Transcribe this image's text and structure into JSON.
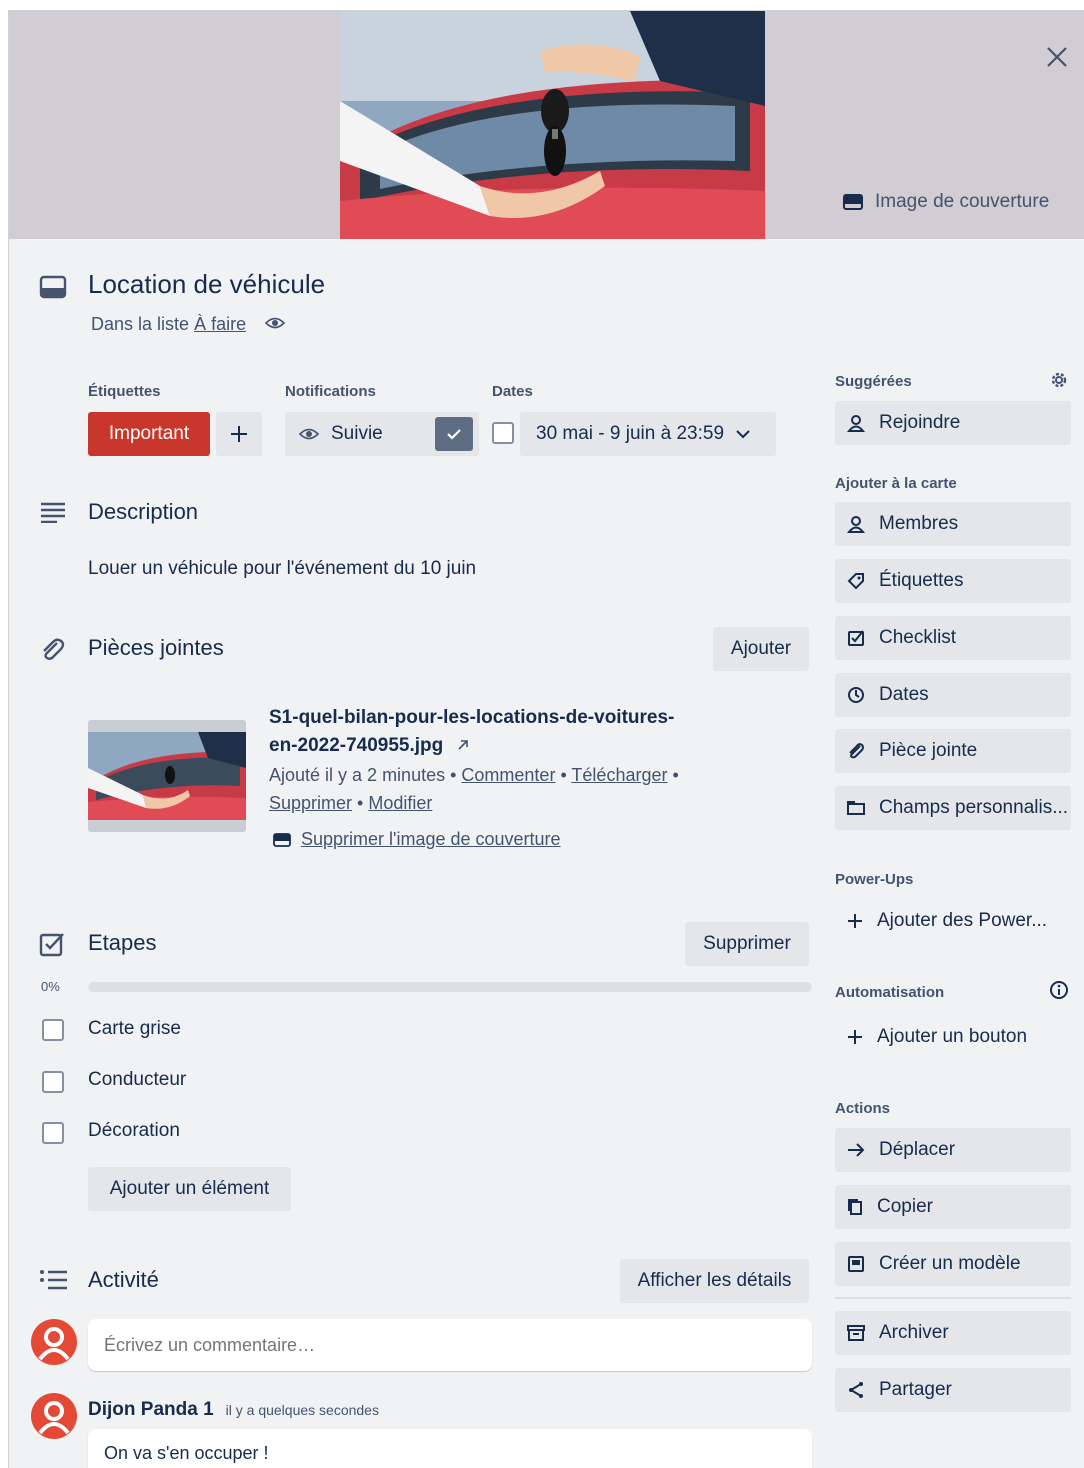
{
  "header": {
    "cover_button": "Image de couverture",
    "card_title": "Location de véhicule",
    "in_list_prefix": "Dans la liste",
    "list_name": "À faire"
  },
  "labels": {
    "labels_heading": "Étiquettes",
    "label_important": "Important",
    "notifications_heading": "Notifications",
    "watch_label": "Suivie",
    "dates_heading": "Dates",
    "dates_value": "30 mai - 9 juin à 23:59"
  },
  "description": {
    "heading": "Description",
    "text": "Louer un véhicule pour l'événement du 10 juin"
  },
  "attachments": {
    "heading": "Pièces jointes",
    "add_button": "Ajouter",
    "file_name_line1": "S1-quel-bilan-pour-les-locations-de-voitures-",
    "file_name_line2": "en-2022-740955.jpg",
    "added": "Ajouté il y a 2 minutes",
    "comment": "Commenter",
    "download": "Télécharger",
    "delete": "Supprimer",
    "edit": "Modifier",
    "remove_cover": "Supprimer l'image de couverture"
  },
  "checklist": {
    "heading": "Etapes",
    "delete_button": "Supprimer",
    "percent": "0%",
    "progress": 0,
    "items": [
      {
        "label": "Carte grise",
        "checked": false
      },
      {
        "label": "Conducteur",
        "checked": false
      },
      {
        "label": "Décoration",
        "checked": false
      }
    ],
    "add_item": "Ajouter un élément"
  },
  "activity": {
    "heading": "Activité",
    "details_button": "Afficher les détails",
    "comment_placeholder": "Écrivez un commentaire…",
    "comments": [
      {
        "author": "Dijon Panda 1",
        "time": "il y a quelques secondes",
        "text": "On va s'en occuper !"
      }
    ]
  },
  "sidebar": {
    "suggested_heading": "Suggérées",
    "join": "Rejoindre",
    "add_to_card_heading": "Ajouter à la carte",
    "add_items": [
      "Membres",
      "Étiquettes",
      "Checklist",
      "Dates",
      "Pièce jointe",
      "Champs personnalis..."
    ],
    "powerups_heading": "Power-Ups",
    "add_powerups": "Ajouter des Power...",
    "automation_heading": "Automatisation",
    "add_button": "Ajouter un bouton",
    "actions_heading": "Actions",
    "actions": [
      "Déplacer",
      "Copier",
      "Créer un modèle"
    ],
    "archive": "Archiver",
    "share": "Partager"
  },
  "colors": {
    "important_label": "#c9372c",
    "watch_check": "#5e6c84",
    "avatar": "#e34935"
  }
}
